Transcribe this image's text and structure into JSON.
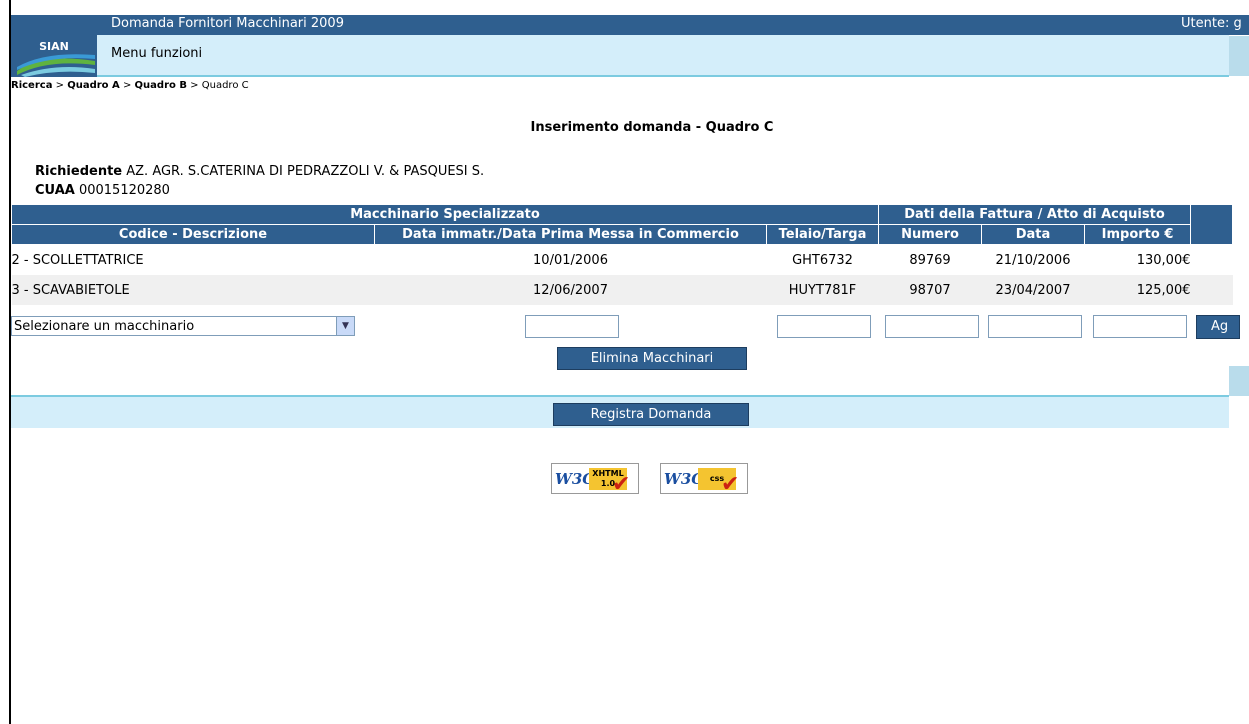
{
  "header": {
    "app_title": "Domanda Fornitori Macchinari 2009",
    "user_label": "Utente: g",
    "menu_label": "Menu funzioni",
    "logo_text": "SIAN"
  },
  "breadcrumb": {
    "items": [
      "Ricerca",
      "Quadro A",
      "Quadro B",
      "Quadro C"
    ],
    "separator": ">"
  },
  "page_title": "Inserimento domanda - Quadro C",
  "applicant": {
    "label": "Richiedente",
    "value": "AZ. AGR. S.CATERINA DI PEDRAZZOLI V. & PASQUESI S.",
    "cuaa_label": "CUAA",
    "cuaa_value": "00015120280"
  },
  "table": {
    "group_headers": [
      "Macchinario Specializzato",
      "Dati della Fattura / Atto di Acquisto"
    ],
    "columns": [
      "Codice - Descrizione",
      "Data immatr./Data Prima Messa in Commercio",
      "Telaio/Targa",
      "Numero",
      "Data",
      "Importo €"
    ],
    "rows": [
      [
        "2 - SCOLLETTATRICE",
        "10/01/2006",
        "GHT6732",
        "89769",
        "21/10/2006",
        "130,00€"
      ],
      [
        "3 - SCAVABIETOLE",
        "12/06/2007",
        "HUYT781F",
        "98707",
        "23/04/2007",
        "125,00€"
      ]
    ]
  },
  "new_row": {
    "select_value": "Selezionare un macchinario",
    "add_button_label": "Ag"
  },
  "buttons": {
    "delete_machines": "Elimina Macchinari",
    "register_application": "Registra Domanda"
  },
  "badges": {
    "xhtml_w3c": "W3C",
    "xhtml_tag": "XHTML 1.0",
    "css_w3c": "W3C",
    "css_tag": "css"
  },
  "colors": {
    "header_dark": "#2f5f8f",
    "header_light": "#d4eefa",
    "accent_line": "#7ccbe0"
  }
}
